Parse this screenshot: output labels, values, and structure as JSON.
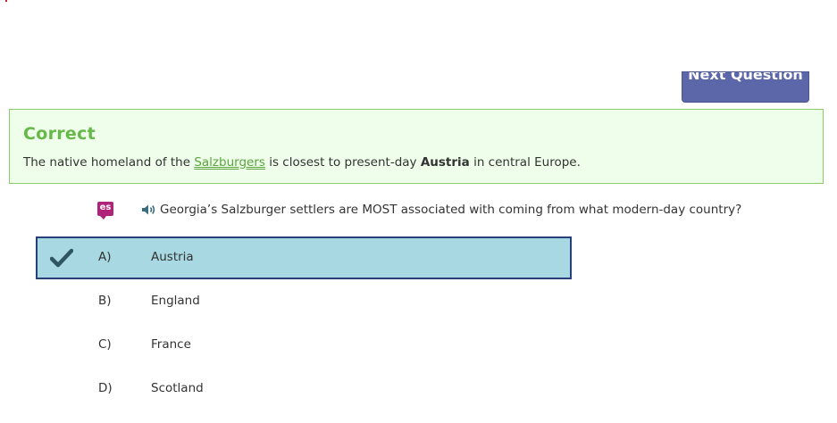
{
  "toolbar": {
    "next_label": "Next Question"
  },
  "feedback": {
    "title": "Correct",
    "text_before": "The native homeland of the ",
    "link_text": "Salzburgers",
    "text_middle": " is closest to present-day ",
    "bold_text": "Austria",
    "text_after": " in central Europe."
  },
  "question": {
    "translate_badge": "es",
    "speaker_icon": "speaker-icon",
    "text": "Georgia’s Salzburger settlers are MOST associated with coming from what modern-day country?"
  },
  "answers": [
    {
      "letter": "A)",
      "text": "Austria",
      "selected": true
    },
    {
      "letter": "B)",
      "text": "England",
      "selected": false
    },
    {
      "letter": "C)",
      "text": "France",
      "selected": false
    },
    {
      "letter": "D)",
      "text": "Scotland",
      "selected": false
    }
  ],
  "colors": {
    "correct_green": "#66b84a",
    "feedback_bg": "#eefeea",
    "selected_bg": "#a8d8e2",
    "selected_border": "#27407a",
    "button_bg": "#5b67a8",
    "badge_bg": "#b0237a"
  }
}
